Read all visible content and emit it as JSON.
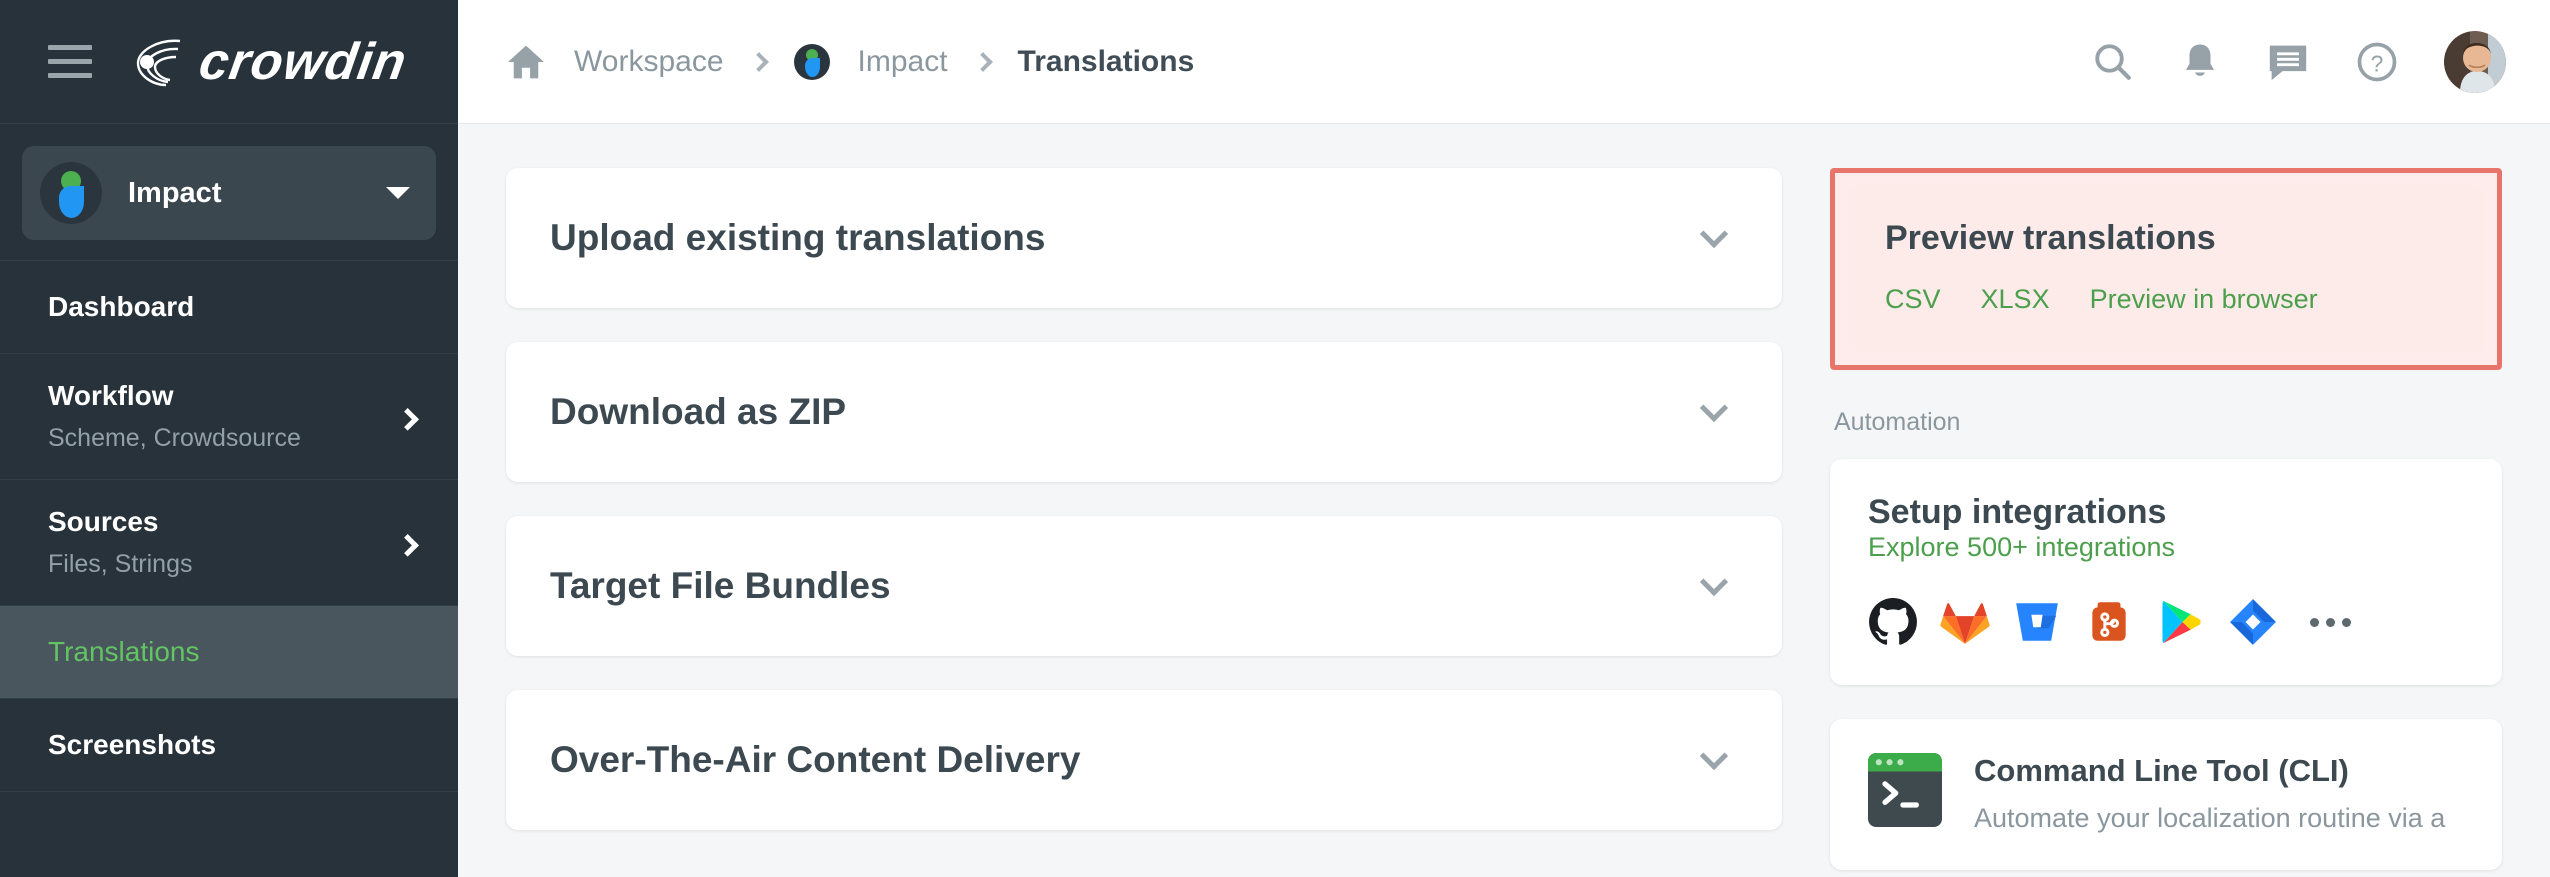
{
  "brand": {
    "name": "crowdin",
    "logo_icon": "crowdin-logo-icon",
    "menu_icon": "hamburger-menu-icon"
  },
  "sidebar": {
    "project": {
      "name": "Impact",
      "avatar_icon": "project-avatar-icon",
      "caret_icon": "caret-down-icon"
    },
    "items": [
      {
        "label": "Dashboard",
        "sub": "",
        "active": false,
        "has_chevron": false
      },
      {
        "label": "Workflow",
        "sub": "Scheme, Crowdsource",
        "active": false,
        "has_chevron": true
      },
      {
        "label": "Sources",
        "sub": "Files, Strings",
        "active": false,
        "has_chevron": true
      },
      {
        "label": "Translations",
        "sub": "",
        "active": true,
        "has_chevron": false
      },
      {
        "label": "Screenshots",
        "sub": "",
        "active": false,
        "has_chevron": false
      }
    ]
  },
  "topbar": {
    "home_icon": "home-icon",
    "breadcrumbs": [
      {
        "label": "Workspace",
        "current": false
      },
      {
        "label": "Impact",
        "current": false,
        "icon": "project-avatar-icon"
      },
      {
        "label": "Translations",
        "current": true
      }
    ],
    "icons": [
      {
        "name": "search-icon"
      },
      {
        "name": "notifications-bell-icon"
      },
      {
        "name": "messages-chat-icon"
      },
      {
        "name": "help-question-icon"
      }
    ],
    "avatar": "user-avatar"
  },
  "main": {
    "accordions": [
      {
        "title": "Upload existing translations",
        "chevron": "chevron-down-icon"
      },
      {
        "title": "Download as ZIP",
        "chevron": "chevron-down-icon"
      },
      {
        "title": "Target File Bundles",
        "chevron": "chevron-down-icon"
      },
      {
        "title": "Over-The-Air Content Delivery",
        "chevron": "chevron-down-icon"
      }
    ]
  },
  "right": {
    "preview": {
      "title": "Preview translations",
      "highlighted": true,
      "links": [
        {
          "label": "CSV"
        },
        {
          "label": "XLSX"
        },
        {
          "label": "Preview in browser"
        }
      ]
    },
    "automation_label": "Automation",
    "integrations": {
      "title": "Setup integrations",
      "link": "Explore 500+ integrations",
      "icons": [
        {
          "name": "github-icon"
        },
        {
          "name": "gitlab-icon"
        },
        {
          "name": "bitbucket-icon"
        },
        {
          "name": "azure-repos-icon"
        },
        {
          "name": "google-play-icon"
        },
        {
          "name": "jira-icon"
        },
        {
          "name": "more-options-icon"
        }
      ]
    },
    "cli": {
      "icon": "terminal-icon",
      "title": "Command Line Tool (CLI)",
      "description": "Automate your localization routine via a"
    }
  },
  "colors": {
    "sidebar_bg": "#27323a",
    "sidebar_active_bg": "#4a565e",
    "accent_green": "#62c462",
    "link_green": "#4c9f4c",
    "highlight_border": "#e8756b",
    "highlight_bg": "#fdeceb",
    "page_bg": "#f4f6f7"
  }
}
